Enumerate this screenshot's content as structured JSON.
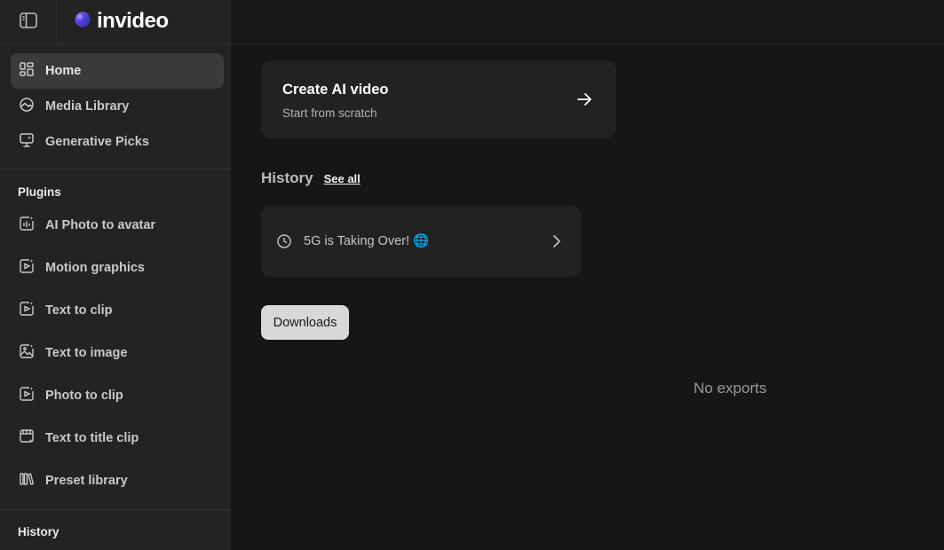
{
  "brand": {
    "name": "invideo",
    "logo_icon": "invideo-logo-icon"
  },
  "sidebar": {
    "toggle_icon": "sidebar-toggle-icon",
    "nav": [
      {
        "label": "Home",
        "icon": "home-grid-icon",
        "active": true
      },
      {
        "label": "Media Library",
        "icon": "media-library-icon",
        "active": false
      },
      {
        "label": "Generative Picks",
        "icon": "generative-picks-icon",
        "active": false
      }
    ],
    "plugins_title": "Plugins",
    "plugins": [
      {
        "label": "AI Photo to avatar",
        "icon": "photo-avatar-icon"
      },
      {
        "label": "Motion graphics",
        "icon": "motion-graphics-icon"
      },
      {
        "label": "Text to clip",
        "icon": "text-to-clip-icon"
      },
      {
        "label": "Text to image",
        "icon": "text-to-image-icon"
      },
      {
        "label": "Photo to clip",
        "icon": "photo-to-clip-icon"
      },
      {
        "label": "Text to title clip",
        "icon": "text-to-title-clip-icon"
      },
      {
        "label": "Preset library",
        "icon": "preset-library-icon"
      }
    ],
    "history_title": "History"
  },
  "main": {
    "create_card": {
      "title": "Create AI video",
      "subtitle": "Start from scratch",
      "icon": "arrow-right-icon"
    },
    "history": {
      "label": "History",
      "see_all": "See all",
      "items": [
        {
          "title": "5G is Taking Over! 🌐",
          "icon": "clock-icon",
          "chevron": "chevron-right-icon"
        }
      ]
    },
    "downloads_label": "Downloads",
    "empty_state": "No exports"
  },
  "colors": {
    "background": "#161616",
    "sidebar": "#232323",
    "card": "#222222",
    "active_nav": "#3a3a3a",
    "downloads_button": "#d8d8d8"
  }
}
